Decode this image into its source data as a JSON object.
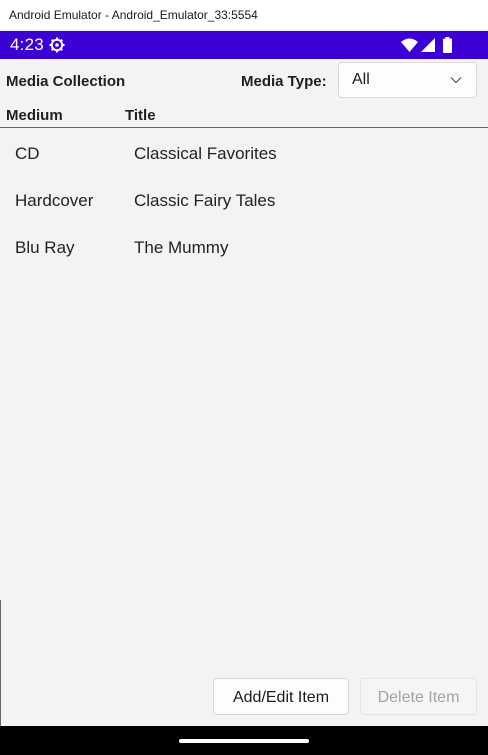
{
  "window": {
    "title": "Android Emulator - Android_Emulator_33:5554"
  },
  "status_bar": {
    "time": "4:23",
    "icons": [
      "settings-gear-icon",
      "wifi-icon",
      "signal-icon",
      "battery-icon"
    ],
    "color": "#3b00d3"
  },
  "header": {
    "title": "Media Collection",
    "media_type_label": "Media Type:",
    "media_type_selected": "All"
  },
  "table": {
    "columns": [
      "Medium",
      "Title"
    ],
    "rows": [
      {
        "medium": "CD",
        "title": "Classical Favorites"
      },
      {
        "medium": "Hardcover",
        "title": "Classic Fairy Tales"
      },
      {
        "medium": "Blu Ray",
        "title": "The Mummy"
      }
    ]
  },
  "buttons": {
    "add_edit": "Add/Edit Item",
    "delete": "Delete Item",
    "delete_enabled": false
  },
  "accent_color": "#7a4ad8"
}
